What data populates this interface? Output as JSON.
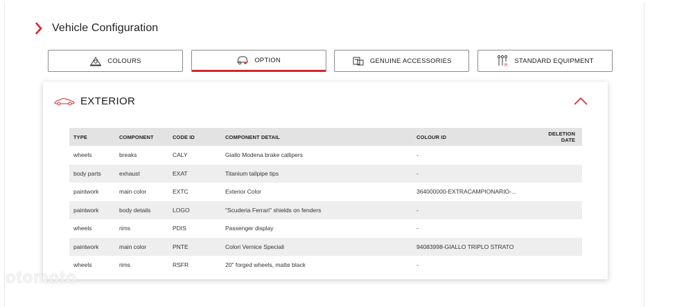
{
  "page": {
    "title": "Vehicle Configuration"
  },
  "tabs": [
    {
      "label": "COLOURS",
      "icon": "palette-icon",
      "active": false
    },
    {
      "label": "OPTION",
      "icon": "car-option-icon",
      "active": true
    },
    {
      "label": "GENUINE ACCESSORIES",
      "icon": "accessories-icon",
      "active": false
    },
    {
      "label": "STANDARD EQUIPMENT",
      "icon": "equipment-icon",
      "active": false
    }
  ],
  "section": {
    "title": "EXTERIOR",
    "icon": "car-icon",
    "collapse_icon": "chevron-up-icon"
  },
  "table": {
    "headers": [
      "TYPE",
      "COMPONENT",
      "CODE ID",
      "COMPONENT DETAIL",
      "COLOUR ID",
      "DELETION DATE"
    ],
    "rows": [
      [
        "wheels",
        "breaks",
        "CALY",
        "Giallo Modena brake callipers",
        "-",
        ""
      ],
      [
        "body parts",
        "exhaust",
        "EXAT",
        "Titanium tailpipe tips",
        "-",
        ""
      ],
      [
        "paintwork",
        "main color",
        "EXTC",
        "Exterior Color",
        "364000000-EXTRACAMPIONARIO-...",
        ""
      ],
      [
        "paintwork",
        "body details",
        "LOGO",
        "\"Scuderia Ferrari\" shields on fenders",
        "-",
        ""
      ],
      [
        "wheels",
        "rims",
        "PDIS",
        "Passenger display",
        "-",
        ""
      ],
      [
        "paintwork",
        "main color",
        "PNTE",
        "Colori Vernice Speciali",
        "94083998-GIALLO TRIPLO STRATO",
        ""
      ],
      [
        "wheels",
        "rims",
        "RSFR",
        "20\" forged wheels, matte black",
        "-",
        ""
      ]
    ]
  },
  "colors": {
    "accent": "#d8232a",
    "header_bg": "#e3e3e3",
    "alt_row": "#eeeeee"
  },
  "watermark": "otomoto"
}
